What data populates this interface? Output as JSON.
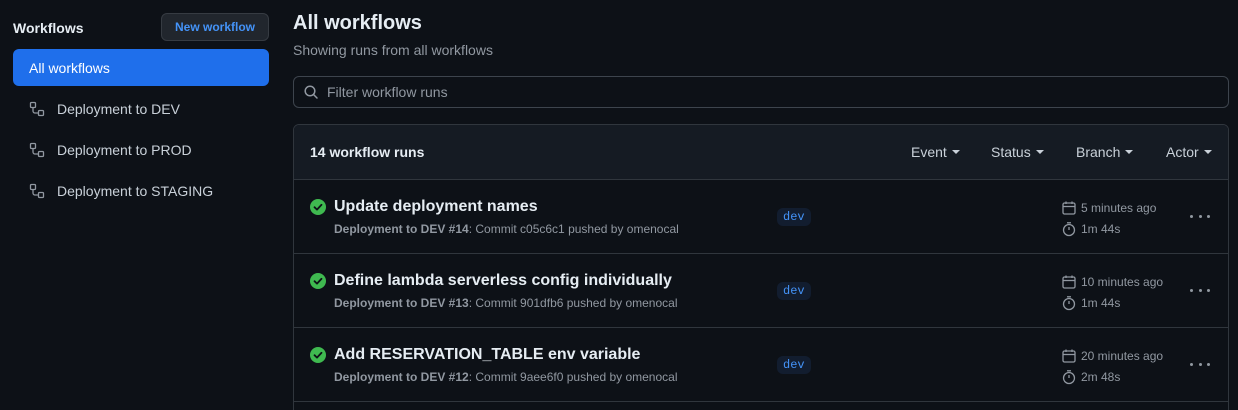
{
  "sidebar": {
    "title": "Workflows",
    "new_button": "New workflow",
    "items": [
      {
        "label": "All workflows",
        "active": true
      },
      {
        "label": "Deployment to DEV",
        "icon": "workflow-icon"
      },
      {
        "label": "Deployment to PROD",
        "icon": "workflow-icon"
      },
      {
        "label": "Deployment to STAGING",
        "icon": "workflow-icon"
      }
    ]
  },
  "main": {
    "title": "All workflows",
    "subtitle": "Showing runs from all workflows",
    "filter_placeholder": "Filter workflow runs",
    "run_count": "14 workflow runs",
    "filters": [
      "Event",
      "Status",
      "Branch",
      "Actor"
    ],
    "runs": [
      {
        "title": "Update deployment names",
        "workflow": "Deployment to DEV #14",
        "meta": ": Commit c05c6c1 pushed by omenocal",
        "branch": "dev",
        "time": "5 minutes ago",
        "duration": "1m 44s",
        "status": "success"
      },
      {
        "title": "Define lambda serverless config individually",
        "workflow": "Deployment to DEV #13",
        "meta": ": Commit 901dfb6 pushed by omenocal",
        "branch": "dev",
        "time": "10 minutes ago",
        "duration": "1m 44s",
        "status": "success"
      },
      {
        "title": "Add RESERVATION_TABLE env variable",
        "workflow": "Deployment to DEV #12",
        "meta": ": Commit 9aee6f0 pushed by omenocal",
        "branch": "dev",
        "time": "20 minutes ago",
        "duration": "2m 48s",
        "status": "success"
      }
    ]
  },
  "colors": {
    "background": "#0d1117",
    "accent": "#1f6feb",
    "link": "#4493f8",
    "success": "#3fb950",
    "muted": "#9198a1"
  }
}
